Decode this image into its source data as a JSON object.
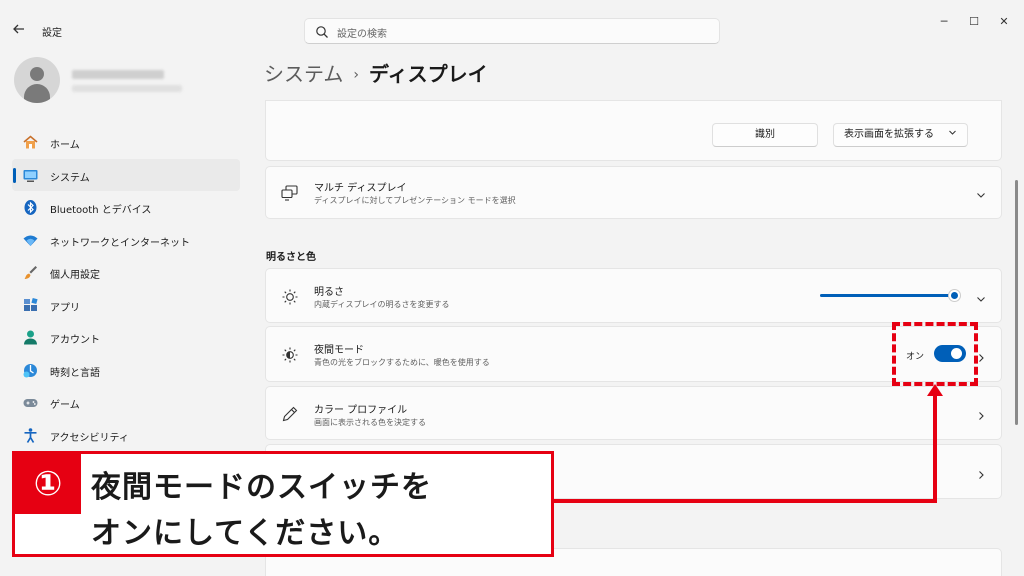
{
  "window": {
    "app_title": "設定",
    "back_icon": "arrow-left-icon",
    "controls": {
      "minimize": "─",
      "maximize": "☐",
      "close": "✕"
    }
  },
  "search": {
    "placeholder": "設定の検索"
  },
  "sidebar": {
    "items": [
      {
        "label": "ホーム",
        "icon": "home-icon"
      },
      {
        "label": "システム",
        "icon": "system-icon",
        "active": true
      },
      {
        "label": "Bluetooth とデバイス",
        "icon": "bluetooth-icon"
      },
      {
        "label": "ネットワークとインターネット",
        "icon": "wifi-icon"
      },
      {
        "label": "個人用設定",
        "icon": "brush-icon"
      },
      {
        "label": "アプリ",
        "icon": "apps-icon"
      },
      {
        "label": "アカウント",
        "icon": "account-icon"
      },
      {
        "label": "時刻と言語",
        "icon": "globe-icon"
      },
      {
        "label": "ゲーム",
        "icon": "gamepad-icon"
      },
      {
        "label": "アクセシビリティ",
        "icon": "accessibility-icon"
      }
    ]
  },
  "breadcrumb": {
    "parent": "システム",
    "separator": "›",
    "current": "ディスプレイ"
  },
  "display_arrangement": {
    "identify_button": "識別",
    "extend_select": "表示画面を拡張する"
  },
  "multi_display": {
    "title": "マルチ ディスプレイ",
    "subtitle": "ディスプレイに対してプレゼンテーション モードを選択"
  },
  "section_brightness_color": "明るさと色",
  "brightness": {
    "title": "明るさ",
    "subtitle": "内蔵ディスプレイの明るさを変更する",
    "value": 0.96
  },
  "night_light": {
    "title": "夜間モード",
    "subtitle": "青色の光をブロックするために、暖色を使用する",
    "state_label": "オン",
    "on": true
  },
  "color_profile": {
    "title": "カラー プロファイル",
    "subtitle": "画面に表示される色を決定する"
  },
  "annotation": {
    "number": "①",
    "line1": "夜間モードのスイッチを",
    "line2": "オンにしてください。"
  },
  "colors": {
    "accent": "#005fb8",
    "annotation_red": "#e60012"
  }
}
